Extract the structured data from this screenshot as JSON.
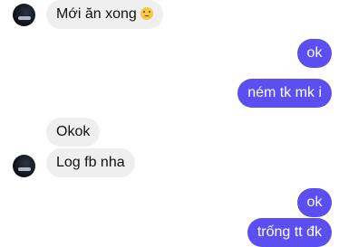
{
  "messages": [
    {
      "side": "in",
      "text": "Mới ăn xong",
      "emoji": "smiling-with-tear-emoji"
    },
    {
      "side": "out",
      "text": "ok"
    },
    {
      "side": "out",
      "text": "ném tk mk i"
    },
    {
      "side": "in",
      "text": "Okok"
    },
    {
      "side": "in",
      "text": "Log fb nha"
    },
    {
      "side": "out",
      "text": "ok"
    },
    {
      "side": "out",
      "text": "trống tt đk"
    }
  ],
  "colors": {
    "incoming_bubble": "#efefef",
    "outgoing_bubble": "#5b4ff2",
    "background": "#ffffff"
  }
}
